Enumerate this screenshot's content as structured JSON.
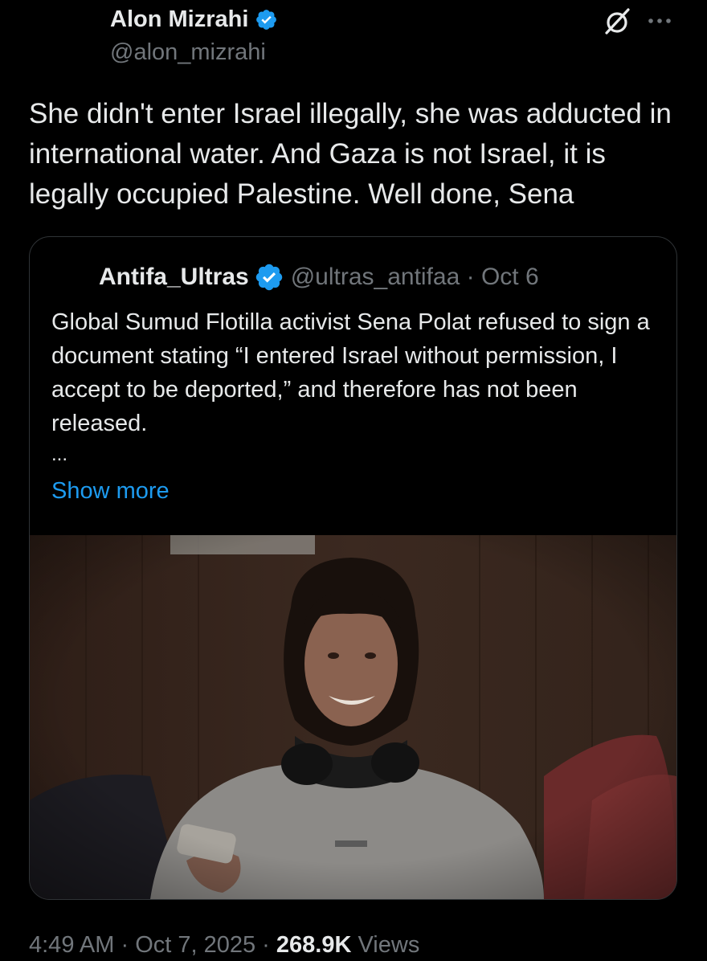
{
  "author": {
    "display_name": "Alon Mizrahi",
    "handle": "@alon_mizrahi",
    "verified_icon": "verified-badge-icon",
    "badge_color": "#1d9bf0"
  },
  "actions": {
    "grok_icon": "grok-icon",
    "more_icon": "more-options-icon"
  },
  "tweet": {
    "text": "She didn't enter Israel illegally, she was adducted in international water. And Gaza is not Israel, it is legally occupied Palestine. Well done, Sena"
  },
  "quote": {
    "display_name": "Antifa_Ultras",
    "handle": "@ultras_antifaa",
    "separator": " · ",
    "date": "Oct 6",
    "text": "Global Sumud Flotilla activist Sena Polat refused to sign a document stating “I entered Israel without permission, I accept to be deported,” and therefore has not been released.",
    "ellipsis": "...",
    "show_more": "Show more",
    "link_color": "#1d9bf0"
  },
  "footer": {
    "time": "4:49 AM",
    "separator": " · ",
    "date": "Oct 7, 2025",
    "views_count": "268.9K",
    "views_label": "Views"
  }
}
